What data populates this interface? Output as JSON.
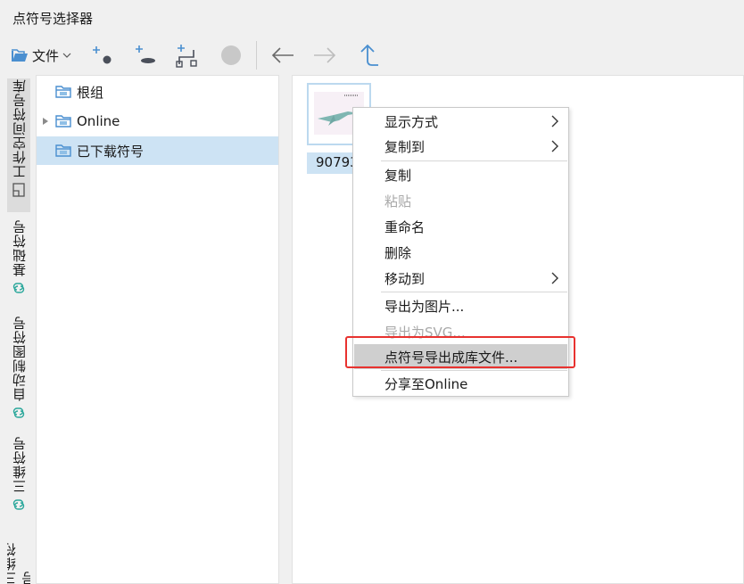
{
  "window": {
    "title": "点符号选择器"
  },
  "toolbar": {
    "file_label": "文件",
    "buttons": [
      {
        "name": "add-point-symbol",
        "icon": "plus-dot-icon"
      },
      {
        "name": "add-line-symbol",
        "icon": "plus-line-icon"
      },
      {
        "name": "add-path-symbol",
        "icon": "plus-path-icon"
      },
      {
        "name": "record",
        "icon": "record-dot-icon"
      },
      {
        "name": "back",
        "icon": "arrow-left-icon"
      },
      {
        "name": "forward",
        "icon": "arrow-right-icon"
      },
      {
        "name": "up",
        "icon": "arrow-up-icon"
      }
    ]
  },
  "side_tabs": [
    {
      "label": "工作空间符号库",
      "active": true
    },
    {
      "label": "基础符号",
      "active": false
    },
    {
      "label": "自动制图符号",
      "active": false
    },
    {
      "label": "三维符号",
      "active": false
    },
    {
      "label": "三维符号",
      "active": false
    }
  ],
  "tree": {
    "items": [
      {
        "label": "根组"
      },
      {
        "label": "Online"
      },
      {
        "label": "已下载符号"
      }
    ]
  },
  "content": {
    "thumb_label": "90793"
  },
  "context_menu": {
    "items": [
      {
        "label": "显示方式"
      },
      {
        "label": "复制到"
      },
      {
        "label": "复制"
      },
      {
        "label": "粘贴"
      },
      {
        "label": "重命名"
      },
      {
        "label": "删除"
      },
      {
        "label": "移动到"
      },
      {
        "label": "导出为图片..."
      },
      {
        "label": "导出为SVG..."
      },
      {
        "label": "点符号导出成库文件..."
      },
      {
        "label": "分享至Online"
      }
    ]
  },
  "colors": {
    "accent": "#4a8fd0",
    "selection": "#cde3f4",
    "highlight_box": "#e8322f",
    "tab_icon": "#2aa79b"
  }
}
